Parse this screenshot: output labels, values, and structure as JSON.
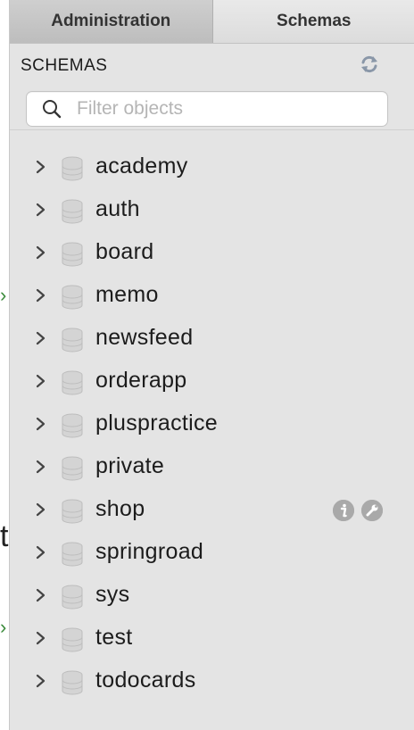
{
  "tabs": [
    {
      "label": "Administration",
      "active": false
    },
    {
      "label": "Schemas",
      "active": true
    }
  ],
  "schemas_panel": {
    "title": "SCHEMAS",
    "refresh_icon": "refresh-icon",
    "filter": {
      "placeholder": "Filter objects",
      "value": ""
    }
  },
  "schemas": [
    {
      "name": "academy"
    },
    {
      "name": "auth"
    },
    {
      "name": "board"
    },
    {
      "name": "memo"
    },
    {
      "name": "newsfeed"
    },
    {
      "name": "orderapp"
    },
    {
      "name": "pluspractice"
    },
    {
      "name": "private"
    },
    {
      "name": "shop",
      "hover_actions": [
        "info-icon",
        "wrench-icon"
      ]
    },
    {
      "name": "springroad"
    },
    {
      "name": "sys"
    },
    {
      "name": "test"
    },
    {
      "name": "todocards"
    }
  ],
  "colors": {
    "panel_bg": "#e4e4e4",
    "inactive_tab": "#c6c6c6",
    "active_tab": "#e2e2e2",
    "text": "#1c1c1c"
  }
}
